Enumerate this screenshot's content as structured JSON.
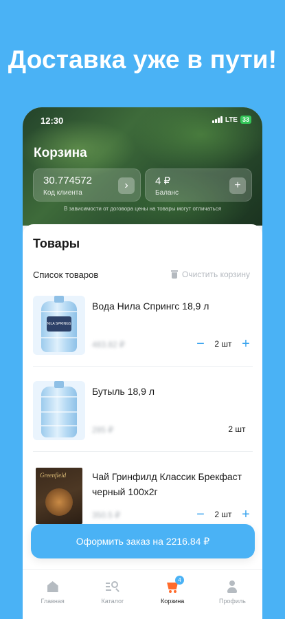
{
  "promo": {
    "title": "Доставка уже в пути!"
  },
  "status_bar": {
    "time": "12:30",
    "network": "LTE",
    "battery": "33"
  },
  "header": {
    "title": "Корзина",
    "client_code": {
      "value": "30.774572",
      "label": "Код клиента"
    },
    "balance": {
      "value": "4 ₽",
      "label": "Баланс"
    },
    "note": "В зависимости от договора цены на товары могут отличаться"
  },
  "cart": {
    "section_title": "Товары",
    "list_title": "Список товаров",
    "clear_label": "Очистить корзину",
    "items": [
      {
        "name": "Вода Нила Спрингс 18,9 л",
        "price": "483.82 ₽",
        "quantity": "2 шт",
        "has_controls": true
      },
      {
        "name": "Бутыль 18,9 л",
        "price": "285 ₽",
        "quantity": "2 шт",
        "has_controls": false
      },
      {
        "name": "Чай Гринфилд Классик Брекфаст черный 100х2г",
        "price": "350.5 ₽",
        "quantity": "2 шт",
        "has_controls": true,
        "brand": "Greenfield"
      }
    ],
    "bottle_label": "NILA SPRINGS"
  },
  "checkout": {
    "label": "Оформить заказ на 2216.84 ₽"
  },
  "tabbar": {
    "items": [
      {
        "label": "Главная",
        "icon": "home-icon"
      },
      {
        "label": "Каталог",
        "icon": "catalog-icon"
      },
      {
        "label": "Корзина",
        "icon": "cart-icon",
        "badge": "4"
      },
      {
        "label": "Профиль",
        "icon": "profile-icon"
      }
    ]
  },
  "colors": {
    "accent": "#4ab2f5",
    "cart_active": "#ff6b2c",
    "qty_control": "#3aa4ee"
  }
}
